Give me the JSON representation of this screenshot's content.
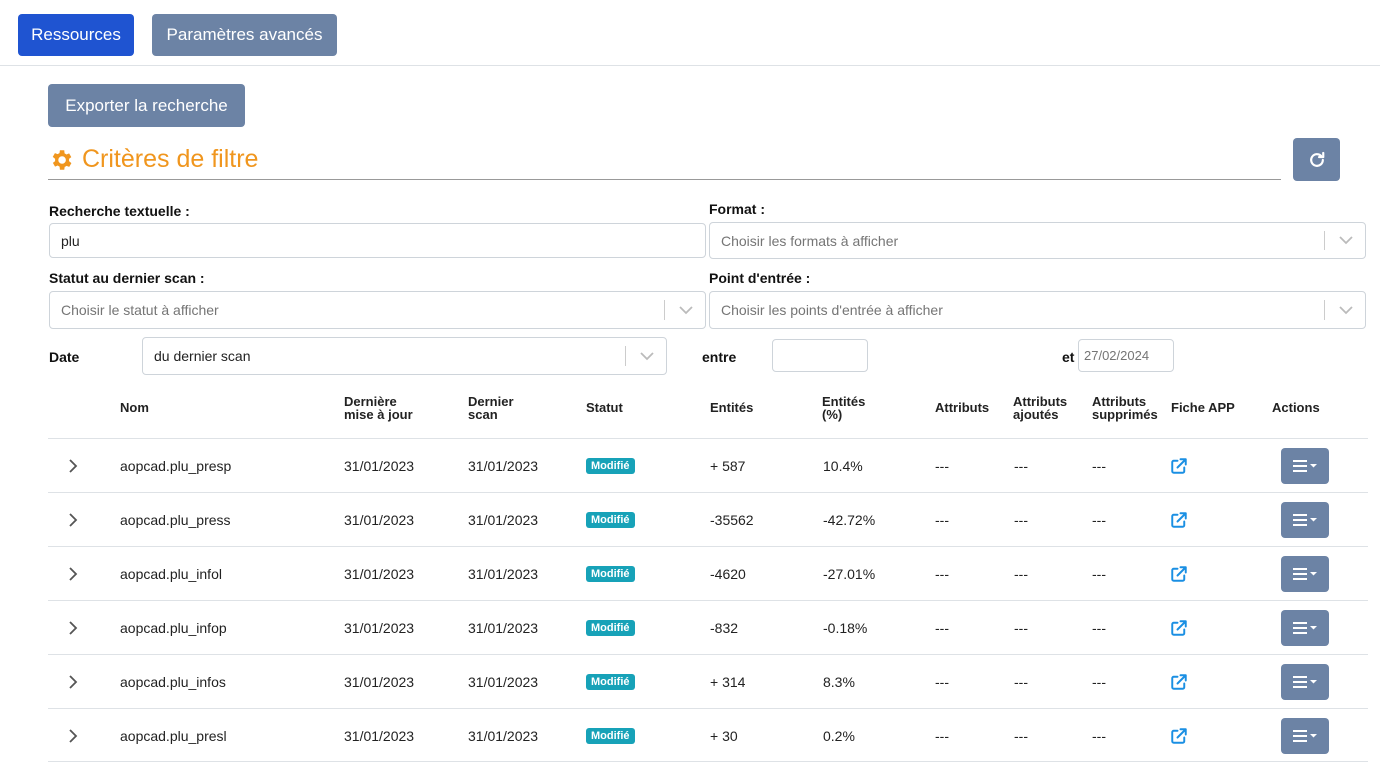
{
  "nav": {
    "resources_label": "Ressources",
    "advanced_label": "Paramètres avancés"
  },
  "export_label": "Exporter la recherche",
  "filters": {
    "title": "Critères de filtre",
    "text_search_label": "Recherche textuelle :",
    "text_search_value": "plu",
    "format_label": "Format :",
    "format_placeholder": "Choisir les formats à afficher",
    "status_label": "Statut au dernier scan :",
    "status_placeholder": "Choisir le statut à afficher",
    "entry_label": "Point d'entrée :",
    "entry_placeholder": "Choisir les points d'entrée à afficher",
    "date_label": "Date",
    "date_value": "du dernier scan",
    "between_label": "entre",
    "between_value": "",
    "and_label": "et",
    "and_placeholder": "27/02/2024"
  },
  "table": {
    "headers": {
      "nom": "Nom",
      "maj": [
        "Dernière",
        "mise à jour"
      ],
      "scan": [
        "Dernier",
        "scan"
      ],
      "statut": "Statut",
      "entites": "Entités",
      "entites_pct": [
        "Entités",
        "(%)"
      ],
      "attributs": "Attributs",
      "attributs_ajoutes": [
        "Attributs",
        "ajoutés"
      ],
      "attributs_supprimes": [
        "Attributs",
        "supprimés"
      ],
      "fiche": "Fiche APP",
      "actions": "Actions"
    },
    "rows": [
      {
        "nom": "aopcad.plu_presp",
        "maj": "31/01/2023",
        "scan": "31/01/2023",
        "statut": "Modifié",
        "entites": "+ 587",
        "pct": "10.4%",
        "attr": "---",
        "added": "---",
        "removed": "---"
      },
      {
        "nom": "aopcad.plu_press",
        "maj": "31/01/2023",
        "scan": "31/01/2023",
        "statut": "Modifié",
        "entites": "-35562",
        "pct": "-42.72%",
        "attr": "---",
        "added": "---",
        "removed": "---"
      },
      {
        "nom": "aopcad.plu_infol",
        "maj": "31/01/2023",
        "scan": "31/01/2023",
        "statut": "Modifié",
        "entites": "-4620",
        "pct": "-27.01%",
        "attr": "---",
        "added": "---",
        "removed": "---"
      },
      {
        "nom": "aopcad.plu_infop",
        "maj": "31/01/2023",
        "scan": "31/01/2023",
        "statut": "Modifié",
        "entites": "-832",
        "pct": "-0.18%",
        "attr": "---",
        "added": "---",
        "removed": "---"
      },
      {
        "nom": "aopcad.plu_infos",
        "maj": "31/01/2023",
        "scan": "31/01/2023",
        "statut": "Modifié",
        "entites": "+ 314",
        "pct": "8.3%",
        "attr": "---",
        "added": "---",
        "removed": "---"
      },
      {
        "nom": "aopcad.plu_presl",
        "maj": "31/01/2023",
        "scan": "31/01/2023",
        "statut": "Modifié",
        "entites": "+ 30",
        "pct": "0.2%",
        "attr": "---",
        "added": "---",
        "removed": "---"
      }
    ]
  },
  "icons": {
    "gear": "gear-icon",
    "refresh": "refresh-icon",
    "chevron": "chevron-down-icon",
    "expand": "chevron-right-icon",
    "external": "external-link-icon",
    "menu": "hamburger-menu-icon"
  },
  "colors": {
    "primary": "#1f54d1",
    "secondary": "#6c83a5",
    "title": "#f0961e",
    "badge": "#17a2b8",
    "link_icon": "#1a8fe3"
  }
}
